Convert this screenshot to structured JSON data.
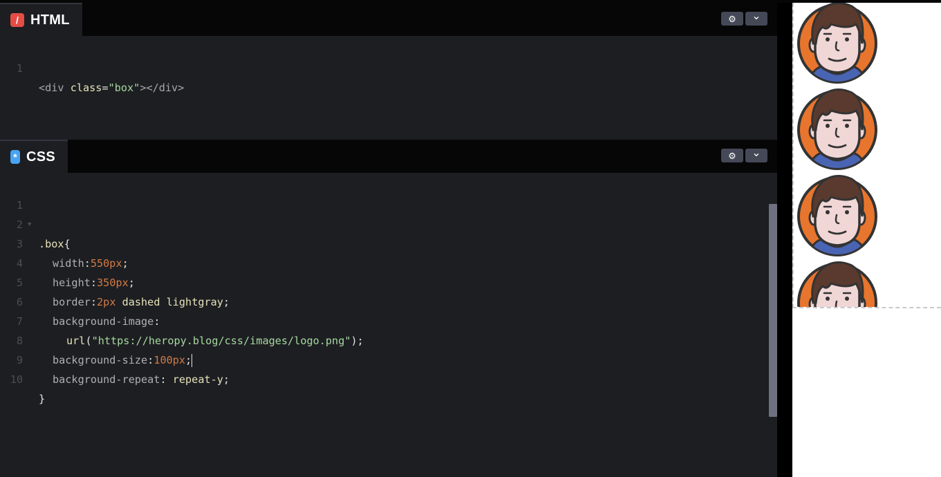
{
  "html_pane": {
    "tab_label": "HTML",
    "tab_icon": "html-logo-icon",
    "accent": "#e44d45",
    "settings_icon": "gear-icon",
    "collapse_icon": "chevron-down-icon",
    "settings_glyph": "⚙",
    "collapse_glyph": "⌄",
    "line_numbers": [
      "1"
    ],
    "code": {
      "l1": {
        "open": "<div ",
        "attr": "class",
        "eq": "=",
        "str": "\"box\"",
        "close": "></div>"
      }
    }
  },
  "css_pane": {
    "tab_label": "CSS",
    "tab_icon": "css-asterisk-icon",
    "accent": "#4aa3f0",
    "settings_icon": "gear-icon",
    "collapse_icon": "chevron-down-icon",
    "settings_glyph": "⚙",
    "collapse_glyph": "⌄",
    "line_numbers": [
      "1",
      "2",
      "3",
      "4",
      "5",
      "6",
      "7",
      "8",
      "9",
      "10"
    ],
    "code": {
      "l1": {
        "selector": ".box",
        "brace": "{"
      },
      "l3": {
        "prop": "width",
        "colon": ":",
        "value": "550px",
        "semi": ";"
      },
      "l4": {
        "prop": "height",
        "colon": ":",
        "value": "350px",
        "semi": ";"
      },
      "l5": {
        "prop": "border",
        "colon": ":",
        "num": "2px",
        "rest": " dashed lightgray",
        "semi": ";"
      },
      "l6": {
        "prop": "background-image",
        "colon": ":"
      },
      "l7": {
        "fn": "url",
        "open": "(",
        "str": "\"https://heropy.blog/css/images/logo.png\"",
        "close": ");"
      },
      "l8": {
        "prop": "background-size",
        "colon": ":",
        "value": "100px",
        "semi": ";"
      },
      "l9": {
        "prop": "background-repeat",
        "colon": ": ",
        "value": "repeat-y",
        "semi": ";"
      },
      "l10": {
        "brace": "}"
      }
    }
  },
  "preview": {
    "image_icon": "avatar-logo-icon",
    "repeat_count": 4
  },
  "colors": {
    "editor_bg": "#1d1e22",
    "header_bg": "#060606",
    "button_bg": "#444857",
    "number": "#d27b45",
    "string": "#a6d9a0",
    "keyword": "#e6e2b9"
  }
}
